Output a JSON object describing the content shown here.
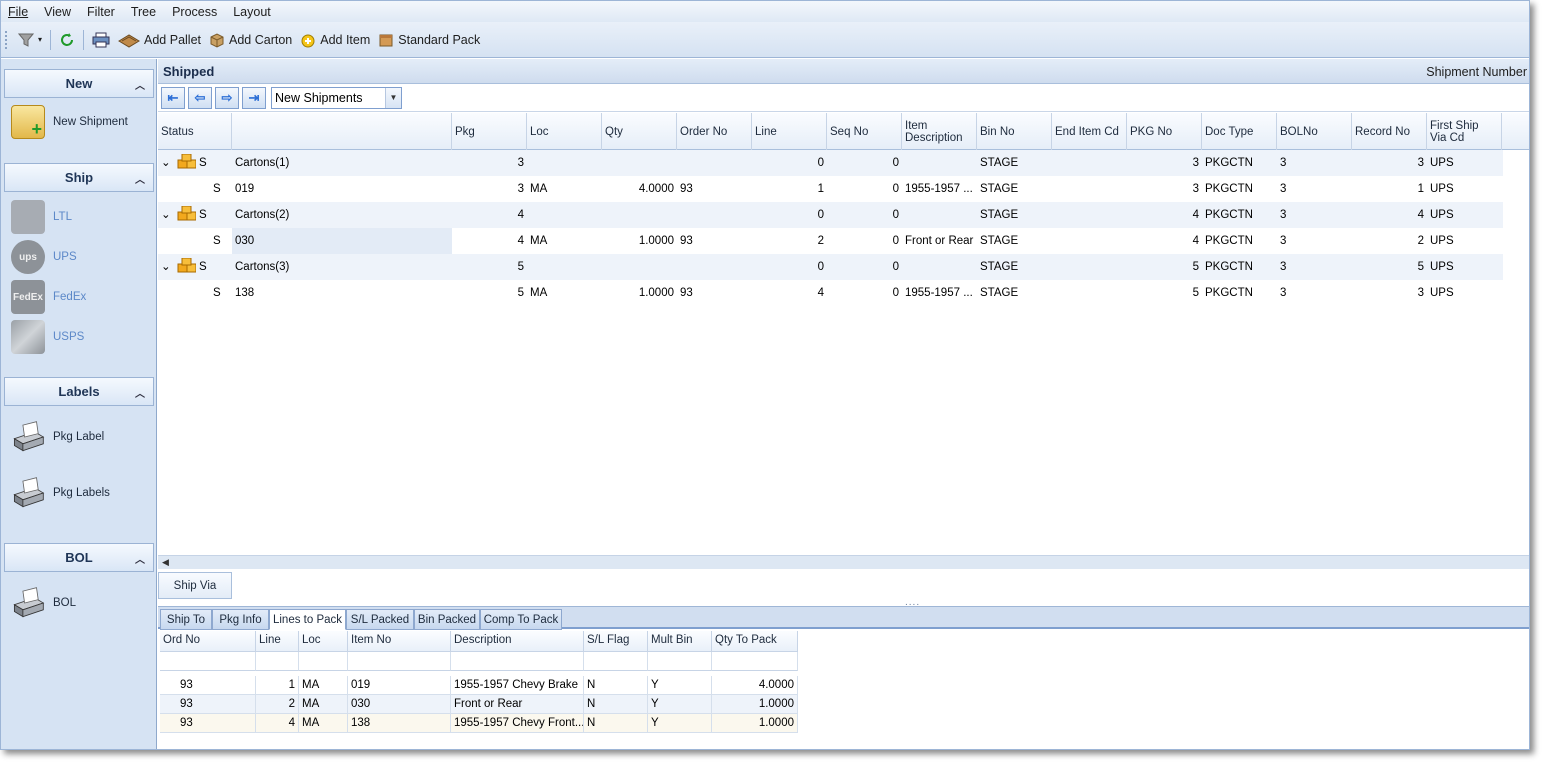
{
  "menu": [
    "File",
    "View",
    "Filter",
    "Tree",
    "Process",
    "Layout"
  ],
  "toolbar": {
    "add_pallet": "Add Pallet",
    "add_carton": "Add Carton",
    "add_item": "Add Item",
    "standard_pack": "Standard Pack"
  },
  "nav": {
    "new": {
      "header": "New",
      "items": [
        "New Shipment"
      ]
    },
    "ship": {
      "header": "Ship",
      "items": [
        "LTL",
        "UPS",
        "FedEx",
        "USPS"
      ]
    },
    "labels": {
      "header": "Labels",
      "items": [
        "Pkg Label",
        "Pkg Labels"
      ]
    },
    "bol": {
      "header": "BOL",
      "items": [
        "BOL"
      ]
    }
  },
  "panel": {
    "title": "Shipped",
    "sort_label": "Shipment Number"
  },
  "filter_combo": "New Shipments",
  "grid": {
    "columns": [
      "Status",
      "",
      "Pkg",
      "Loc",
      "Qty",
      "Order No",
      "Line",
      "Seq No",
      "Item Description",
      "Bin No",
      "End Item Cd",
      "PKG No",
      "Doc Type",
      "BOLNo",
      "Record No",
      "First Ship Via Cd"
    ],
    "rows": [
      {
        "group": true,
        "status": "S",
        "name": "Cartons(1)",
        "pkg": "3",
        "loc": "",
        "qty": "",
        "order": "",
        "line": "0",
        "seq": "0",
        "desc": "",
        "bin": "STAGE",
        "end": "",
        "pkgno": "3",
        "doc": "PKGCTN",
        "bol": "3",
        "rec": "3",
        "via": "UPS"
      },
      {
        "group": false,
        "status": "S",
        "name": "019",
        "pkg": "3",
        "loc": "MA",
        "qty": "4.0000",
        "order": "93",
        "line": "1",
        "seq": "0",
        "desc": "1955-1957 ...",
        "bin": "STAGE",
        "end": "",
        "pkgno": "3",
        "doc": "PKGCTN",
        "bol": "3",
        "rec": "1",
        "via": "UPS"
      },
      {
        "group": true,
        "status": "S",
        "name": "Cartons(2)",
        "pkg": "4",
        "loc": "",
        "qty": "",
        "order": "",
        "line": "0",
        "seq": "0",
        "desc": "",
        "bin": "STAGE",
        "end": "",
        "pkgno": "4",
        "doc": "PKGCTN",
        "bol": "3",
        "rec": "4",
        "via": "UPS"
      },
      {
        "group": false,
        "status": "S",
        "name": "030",
        "pkg": "4",
        "loc": "MA",
        "qty": "1.0000",
        "order": "93",
        "line": "2",
        "seq": "0",
        "desc": "Front or Rear",
        "bin": "STAGE",
        "end": "",
        "pkgno": "4",
        "doc": "PKGCTN",
        "bol": "3",
        "rec": "2",
        "via": "UPS"
      },
      {
        "group": true,
        "status": "S",
        "name": "Cartons(3)",
        "pkg": "5",
        "loc": "",
        "qty": "",
        "order": "",
        "line": "0",
        "seq": "0",
        "desc": "",
        "bin": "STAGE",
        "end": "",
        "pkgno": "5",
        "doc": "PKGCTN",
        "bol": "3",
        "rec": "5",
        "via": "UPS"
      },
      {
        "group": false,
        "status": "S",
        "name": "138",
        "pkg": "5",
        "loc": "MA",
        "qty": "1.0000",
        "order": "93",
        "line": "4",
        "seq": "0",
        "desc": "1955-1957 ...",
        "bin": "STAGE",
        "end": "",
        "pkgno": "5",
        "doc": "PKGCTN",
        "bol": "3",
        "rec": "3",
        "via": "UPS"
      }
    ]
  },
  "ship_via_button": "Ship Via",
  "tabs": [
    "Ship To",
    "Pkg Info",
    "Lines to Pack",
    "S/L Packed",
    "Bin Packed",
    "Comp To Pack"
  ],
  "active_tab": "Lines to Pack",
  "lines": {
    "columns": [
      "Ord No",
      "Line",
      "Loc",
      "Item No",
      "Description",
      "S/L Flag",
      "Mult Bin",
      "Qty To Pack"
    ],
    "rows": [
      [
        "93",
        "1",
        "MA",
        "019",
        "1955-1957 Chevy Brake",
        "N",
        "Y",
        "4.0000"
      ],
      [
        "93",
        "2",
        "MA",
        "030",
        "Front or Rear",
        "N",
        "Y",
        "1.0000"
      ],
      [
        "93",
        "4",
        "MA",
        "138",
        "1955-1957 Chevy Front...",
        "N",
        "Y",
        "1.0000"
      ]
    ]
  }
}
